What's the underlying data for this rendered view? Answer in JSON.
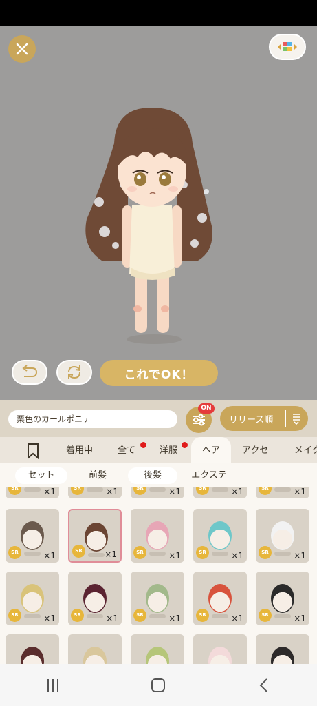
{
  "stage": {
    "close_icon": "close-icon",
    "palette_icon": "palette-icon",
    "undo_icon": "undo-icon",
    "swap_icon": "swap-icon",
    "ok_label": "これでOK！"
  },
  "filter": {
    "search_value": "栗色のカールポニテ",
    "filter_icon": "sliders-icon",
    "on_badge": "ON",
    "sort_label": "リリース順",
    "sort_icon": "sort-icon"
  },
  "tabs": [
    {
      "label": "",
      "icon": "bookmark-icon"
    },
    {
      "label": "着用中"
    },
    {
      "label": "全て",
      "dot": true
    },
    {
      "label": "洋服",
      "dot": true
    },
    {
      "label": "ヘア",
      "active": true
    },
    {
      "label": "アクセ"
    },
    {
      "label": "メイク"
    }
  ],
  "subtabs": [
    {
      "label": "セット"
    },
    {
      "label": "前髪"
    },
    {
      "label": "後髪"
    },
    {
      "label": "エクステ"
    }
  ],
  "grid": {
    "badge": "SR",
    "qty": "×1",
    "selected_index": 6
  },
  "colors": {
    "accent_gold": "#c9a65a",
    "ok_button": "#d8b565",
    "badge_red": "#e53b3b",
    "sr_badge": "#e7b63b"
  },
  "nav": {
    "recents_icon": "recents-icon",
    "home_icon": "home-icon",
    "back_icon": "back-icon"
  }
}
